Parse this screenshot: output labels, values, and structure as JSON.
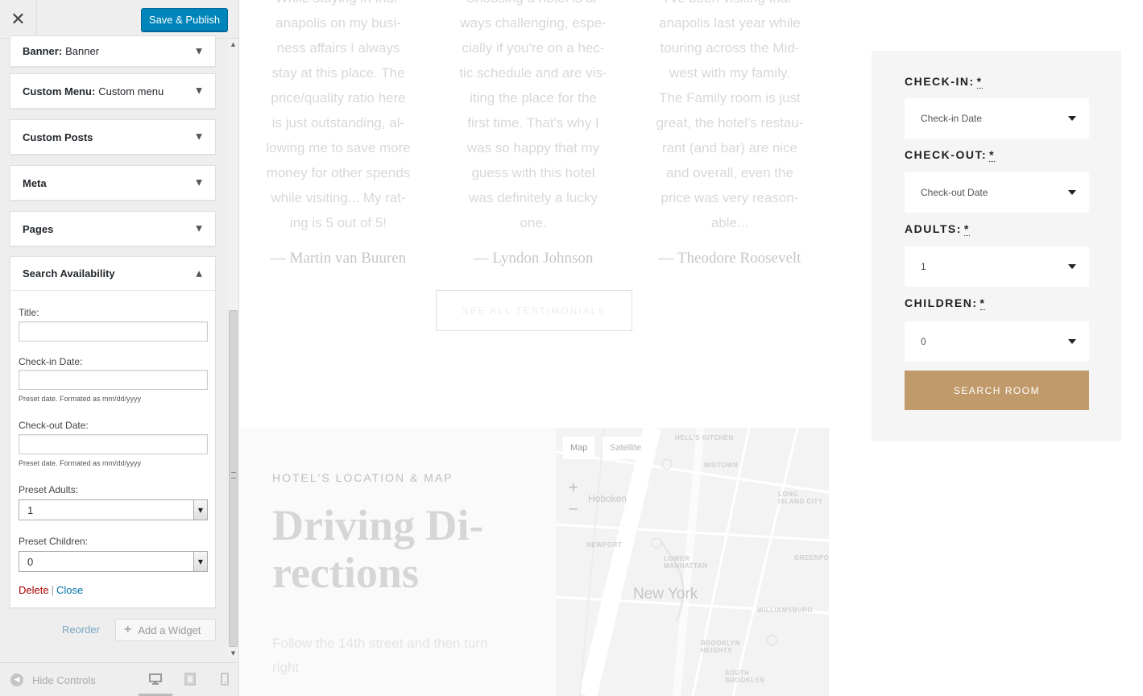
{
  "customizer": {
    "close_glyph": "✕",
    "save_label": "Save & Publish",
    "widgets": [
      {
        "title": "Banner:",
        "subtitle": "Banner"
      },
      {
        "title": "Custom Menu:",
        "subtitle": "Custom menu"
      },
      {
        "title": "Custom Posts",
        "subtitle": ""
      },
      {
        "title": "Meta",
        "subtitle": ""
      },
      {
        "title": "Pages",
        "subtitle": ""
      }
    ],
    "search_widget": {
      "title": "Search Availability",
      "fields": {
        "title_label": "Title:",
        "title_value": "",
        "checkin_label": "Check-in Date:",
        "checkin_value": "",
        "checkin_hint": "Preset date. Formated as mm/dd/yyyy",
        "checkout_label": "Check-out Date:",
        "checkout_value": "",
        "checkout_hint": "Preset date. Formated as mm/dd/yyyy",
        "adults_label": "Preset Adults:",
        "adults_value": "1",
        "children_label": "Preset Children:",
        "children_value": "0"
      },
      "delete_label": "Delete",
      "separator": "|",
      "close_label": "Close"
    },
    "reorder_label": "Reorder",
    "add_widget_label": "Add a Widget",
    "hide_controls_label": "Hide Controls"
  },
  "preview": {
    "testimonials": [
      {
        "text": "While staying in Indi-\nanapolis on my busi-\nness affairs I always\nstay at this place. The\nprice/quality ratio here\nis just outstanding, al-\nlowing me to save more\nmoney for other spends\nwhile visiting... My rat-\ning is 5 out of 5!",
        "author": "— Martin van Buuren"
      },
      {
        "text": "Choosing a hotel is al-\nways challenging, espe-\ncially if you're on a hec-\ntic schedule and are vis-\niting the place for the\nfirst time. That's why I\nwas so happy that my\nguess with this hotel\nwas definitely a lucky\none.",
        "author": "— Lyndon Johnson"
      },
      {
        "text": "I've been visiting Indi-\nanapolis last year while\ntouring across the Mid-\nwest with my family.\nThe Family room is just\ngreat, the hotel's restau-\nrant (and bar) are nice\nand overall, even the\nprice was very reason-\nable...",
        "author": "— Theodore Roosevelt"
      }
    ],
    "see_all_label": "SEE ALL TESTIMONIALS",
    "location": {
      "kicker": "HOTEL'S LOCATION & MAP",
      "title": "Driving Di-\nrections",
      "text": "Follow the 14th street and then turn right"
    },
    "map": {
      "type_map": "Map",
      "type_satellite": "Satellite",
      "zoom_in": "+",
      "zoom_out": "−",
      "labels": {
        "hells_kitchen": "HELL'S KITCHEN",
        "midtown": "MIDTOWN",
        "long_island_city": "LONG ISLAND CITY",
        "hoboken": "Hoboken",
        "newport": "NEWPORT",
        "lower_manhattan": "LOWER MANHATTAN",
        "greenpoint": "GREENPOI",
        "new_york": "New York",
        "williamsburg": "WILLIAMSBURG",
        "brooklyn_heights": "BROOKLYN HEIGHTS",
        "south_brooklyn": "SOUTH BROOKLYN"
      }
    },
    "booking": {
      "checkin_label": "CHECK-IN:",
      "checkin_value": "Check-in Date",
      "checkout_label": "CHECK-OUT:",
      "checkout_value": "Check-out Date",
      "adults_label": "ADULTS:",
      "adults_value": "1",
      "children_label": "CHILDREN:",
      "children_value": "0",
      "required_mark": "*",
      "search_label": "SEARCH ROOM",
      "accent_color": "#c19a6b"
    }
  }
}
